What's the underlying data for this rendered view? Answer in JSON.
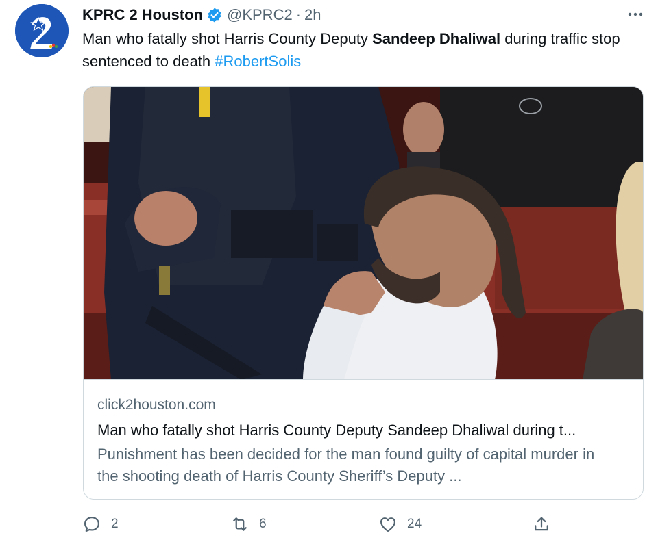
{
  "account": {
    "display_name": "KPRC 2 Houston",
    "handle": "@KPRC2",
    "separator": "·",
    "time": "2h",
    "verified": true,
    "avatar_logo": "2"
  },
  "tweet": {
    "text_before": "Man who fatally shot Harris County Deputy ",
    "text_bold": "Sandeep Dhaliwal",
    "text_after": " during traffic stop sentenced to death ",
    "hashtag": "#RobertSolis"
  },
  "card": {
    "domain": "click2houston.com",
    "title": "Man who fatally shot Harris County Deputy Sandeep Dhaliwal during t...",
    "description": "Punishment has been decided for the man found guilty of capital murder in the shooting death of Harris County Sheriff’s Deputy ..."
  },
  "actions": {
    "reply_count": "2",
    "retweet_count": "6",
    "like_count": "24"
  },
  "icons": {
    "verified": "verified-badge-icon",
    "more": "more-options-icon",
    "reply": "reply-icon",
    "retweet": "retweet-icon",
    "like": "heart-icon",
    "share": "share-icon"
  },
  "colors": {
    "text": "#0f1419",
    "secondary": "#536471",
    "link": "#1d9bf0",
    "verified": "#1d9bf0",
    "border": "#cfd9de",
    "avatar_bg": "#1d56b7"
  }
}
